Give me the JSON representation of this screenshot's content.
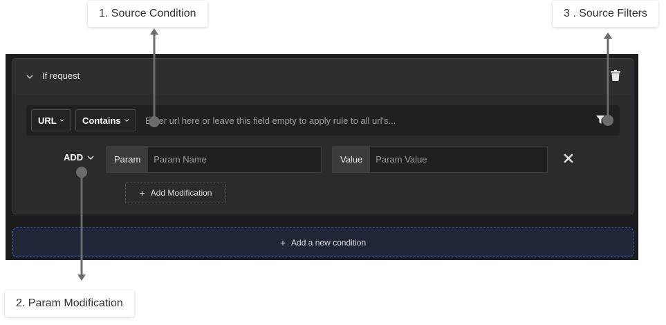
{
  "callouts": {
    "source_condition": "1. Source Condition",
    "param_modification": "2. Param Modification",
    "source_filters": "3 . Source Filters"
  },
  "rule_card": {
    "title": "If request",
    "collapse_icon": "chevron-down-icon",
    "delete_icon": "trash-icon"
  },
  "condition": {
    "field_dropdown": "URL",
    "operator_dropdown": "Contains",
    "url_placeholder": "Enter url here or leave this field empty to apply rule to all url's...",
    "filter_icon": "filter-icon"
  },
  "modification": {
    "action_dropdown": "ADD",
    "param_label": "Param",
    "param_placeholder": "Param Name",
    "value_label": "Value",
    "value_placeholder": "Param Value",
    "remove_icon": "close-icon",
    "add_modification_label": "Add Modification"
  },
  "add_condition_label": "Add a new condition",
  "colors": {
    "panel_bg": "#1c1d1f",
    "card_bg": "#2a2b2e",
    "pointer": "#6b6b70",
    "accent_border": "#3f6bc4"
  }
}
